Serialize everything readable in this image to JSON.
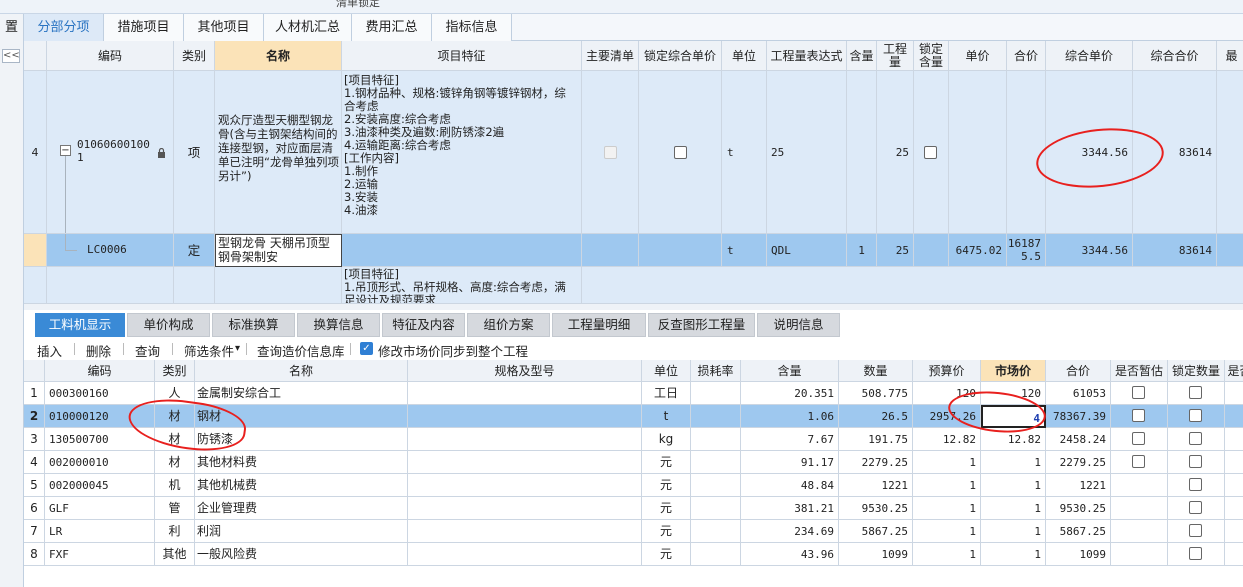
{
  "window": {
    "title": "清单锁定"
  },
  "main_tabs": [
    "分部分项",
    "措施项目",
    "其他项目",
    "人材机汇总",
    "费用汇总",
    "指标信息"
  ],
  "left_edge": {
    "label": "置",
    "collapse": "<<"
  },
  "upper_grid": {
    "headers": [
      "编码",
      "类别",
      "名称",
      "项目特征",
      "主要清单",
      "锁定综合单价",
      "单位",
      "工程量表达式",
      "含量",
      "工程量",
      "锁定含量",
      "单价",
      "合价",
      "综合单价",
      "综合合价",
      "最"
    ],
    "rows": [
      {
        "rownum": "4",
        "code": "01060600100\n1",
        "tree_toggle": "−",
        "type": "项",
        "name": "观众厅造型天棚型钢龙骨(含与主钢架结构间的连接型钢，对应面层清单已注明“龙骨单独列项另计”)",
        "feature": "[项目特征]\n1.钢材品种、规格:镀锌角钢等镀锌钢材，综\n合考虑\n2.安装高度:综合考虑\n3.油漆种类及遍数:刷防锈漆2遍\n4.运输距离:综合考虑\n[工作内容]\n1.制作\n2.运输\n3.安装\n4.油漆",
        "unit": "t",
        "expr": "25",
        "content": "",
        "quantity": "25",
        "price": "",
        "total": "",
        "comp_price": "3344.56",
        "comp_total": "83614"
      },
      {
        "rownum": "",
        "code": "LC0006",
        "type": "定",
        "name": "型钢龙骨 天棚吊顶型钢骨架制安",
        "feature": "",
        "unit": "t",
        "expr": "QDL",
        "content": "1",
        "quantity": "25",
        "price": "6475.02",
        "total": "16187\n5.5",
        "comp_price": "3344.56",
        "comp_total": "83614"
      },
      {
        "rownum": "",
        "feature": "[项目特征]\n1.吊顶形式、吊杆规格、高度:综合考虑，满\n足设计及规范要求"
      }
    ]
  },
  "bottom_tabs": [
    "工料机显示",
    "单价构成",
    "标准换算",
    "换算信息",
    "特征及内容",
    "组价方案",
    "工程量明细",
    "反查图形工程量",
    "说明信息"
  ],
  "toolbar": {
    "insert": "插入",
    "delete": "删除",
    "query": "查询",
    "filter": "筛选条件",
    "filter_caret": "▾",
    "query_price": "查询造价信息库",
    "sync_label": "修改市场价同步到整个工程",
    "sync_checked": true
  },
  "lower_grid": {
    "headers": [
      "编码",
      "类别",
      "名称",
      "规格及型号",
      "单位",
      "损耗率",
      "含量",
      "数量",
      "预算价",
      "市场价",
      "合价",
      "是否暂估",
      "锁定数量",
      "是否"
    ],
    "rows": [
      {
        "n": "1",
        "code": "000300160",
        "type": "人",
        "name": "金属制安综合工",
        "spec": "",
        "unit": "工日",
        "loss": "",
        "content": "20.351",
        "qty": "508.775",
        "budget": "120",
        "market": "120",
        "total": "61053",
        "est": false,
        "lock": false
      },
      {
        "n": "2",
        "code": "010000120",
        "type": "材",
        "name": "钢材",
        "spec": "",
        "unit": "t",
        "loss": "",
        "content": "1.06",
        "qty": "26.5",
        "budget": "2957.26",
        "market": "4",
        "total": "78367.39",
        "est": false,
        "lock": false
      },
      {
        "n": "3",
        "code": "130500700",
        "type": "材",
        "name": "防锈漆",
        "spec": "",
        "unit": "kg",
        "loss": "",
        "content": "7.67",
        "qty": "191.75",
        "budget": "12.82",
        "market": "12.82",
        "total": "2458.24",
        "est": false,
        "lock": false
      },
      {
        "n": "4",
        "code": "002000010",
        "type": "材",
        "name": "其他材料费",
        "spec": "",
        "unit": "元",
        "loss": "",
        "content": "91.17",
        "qty": "2279.25",
        "budget": "1",
        "market": "1",
        "total": "2279.25",
        "est": false,
        "lock": false
      },
      {
        "n": "5",
        "code": "002000045",
        "type": "机",
        "name": "其他机械费",
        "spec": "",
        "unit": "元",
        "loss": "",
        "content": "48.84",
        "qty": "1221",
        "budget": "1",
        "market": "1",
        "total": "1221",
        "est": null,
        "lock": false
      },
      {
        "n": "6",
        "code": "GLF",
        "type": "管",
        "name": "企业管理费",
        "spec": "",
        "unit": "元",
        "loss": "",
        "content": "381.21",
        "qty": "9530.25",
        "budget": "1",
        "market": "1",
        "total": "9530.25",
        "est": null,
        "lock": false
      },
      {
        "n": "7",
        "code": "LR",
        "type": "利",
        "name": "利润",
        "spec": "",
        "unit": "元",
        "loss": "",
        "content": "234.69",
        "qty": "5867.25",
        "budget": "1",
        "market": "1",
        "total": "5867.25",
        "est": null,
        "lock": false
      },
      {
        "n": "8",
        "code": "FXF",
        "type": "其他",
        "name": "一般风险费",
        "spec": "",
        "unit": "元",
        "loss": "",
        "content": "43.96",
        "qty": "1099",
        "budget": "1",
        "market": "1",
        "total": "1099",
        "est": null,
        "lock": false
      }
    ]
  },
  "colors": {
    "accent": "#3a8ad6",
    "selected_row": "#9ec8ef",
    "annotation": "#e8201e"
  }
}
